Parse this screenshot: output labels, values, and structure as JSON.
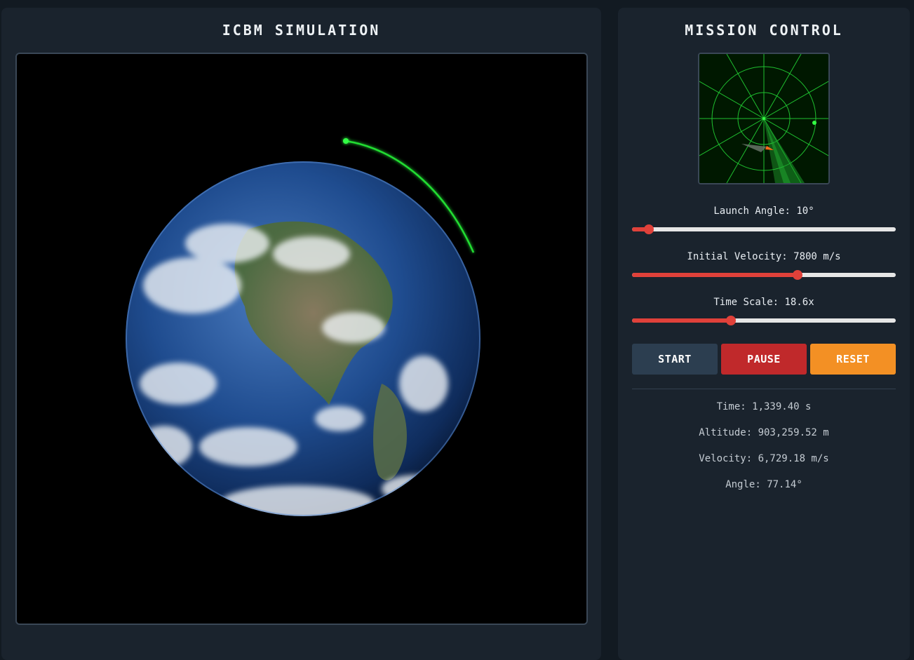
{
  "left_panel": {
    "title": "ICBM SIMULATION"
  },
  "right_panel": {
    "title": "MISSION CONTROL"
  },
  "controls": {
    "launch_angle": {
      "label": "Launch Angle: 10°",
      "fraction": 0.065
    },
    "initial_velocity": {
      "label": "Initial Velocity: 7800 m/s",
      "fraction": 0.627
    },
    "time_scale": {
      "label": "Time Scale: 18.6x",
      "fraction": 0.374
    }
  },
  "buttons": {
    "start": "START",
    "pause": "PAUSE",
    "reset": "RESET"
  },
  "stats": {
    "time": "Time: 1,339.40 s",
    "altitude": "Altitude: 903,259.52 m",
    "velocity": "Velocity: 6,729.18 m/s",
    "angle": "Angle: 77.14°"
  },
  "colors": {
    "trajectory": "#22dd33",
    "slider_accent": "#e0413a",
    "radar_green": "#1fbf2f",
    "start_button": "#2c3e50",
    "pause_button": "#c0292b",
    "reset_button": "#f39024"
  }
}
